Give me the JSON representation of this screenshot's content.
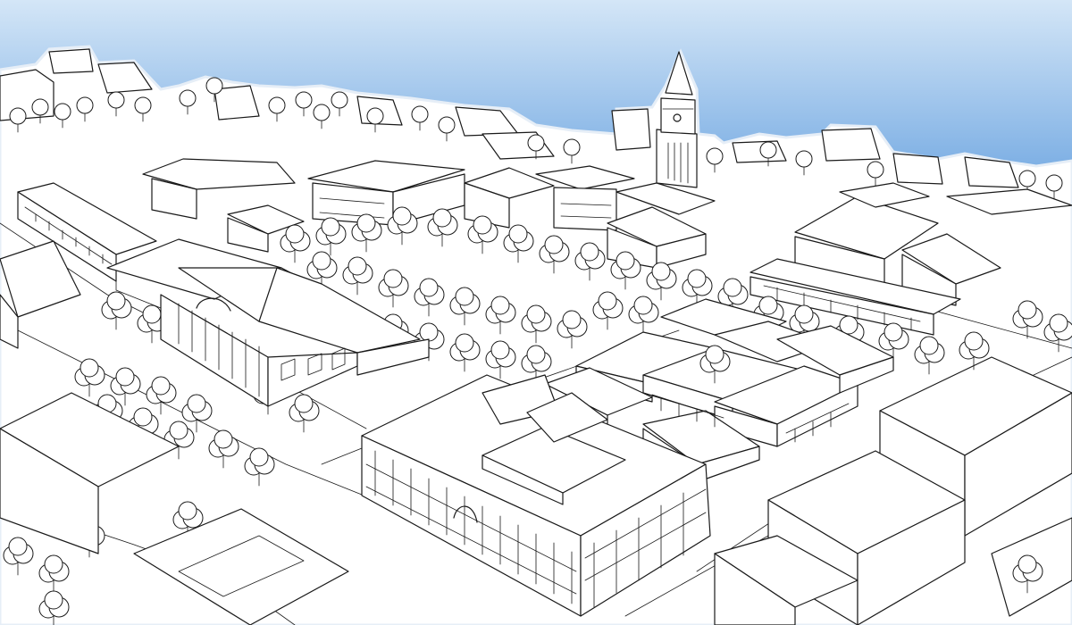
{
  "scene": {
    "sky_color_top": "#c9dff4",
    "sky_color_bottom": "#7fb2e6",
    "paper_color": "#ffffff",
    "ink_color": "#1a1a1a"
  }
}
